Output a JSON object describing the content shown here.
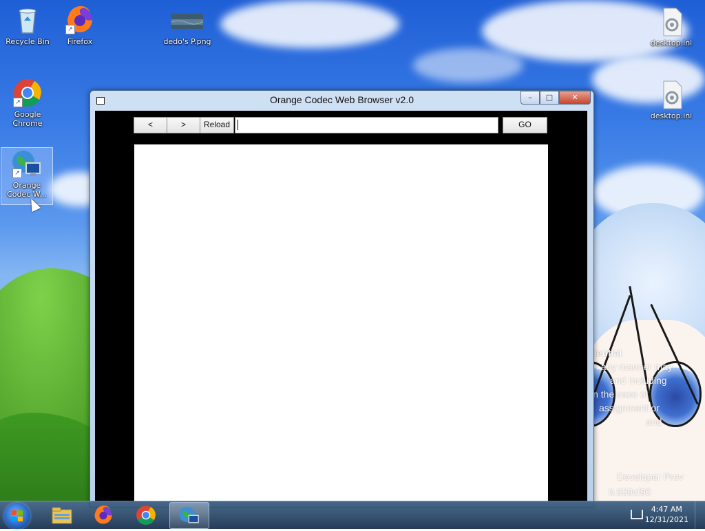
{
  "desktop": {
    "icons": [
      {
        "label": "Recycle Bin",
        "icon": "recycle-bin-icon"
      },
      {
        "label": "Firefox",
        "icon": "firefox-icon"
      },
      {
        "label": "dedo's P.png",
        "icon": "image-file-icon"
      },
      {
        "label": "desktop.ini",
        "icon": "settings-file-icon"
      },
      {
        "label": "Google Chrome",
        "icon": "chrome-icon"
      },
      {
        "label": "desktop.ini",
        "icon": "settings-file-icon"
      },
      {
        "label": "Orange Codec W...",
        "icon": "orange-codec-browser-icon"
      }
    ],
    "wallpaper_text": [
      "dential",
      "in any manner may",
      "and including",
      "in the case of",
      "assignment or",
      "and",
      "Developer Prev",
      "0.959cf95"
    ]
  },
  "window": {
    "title": "Orange Codec Web Browser v2.0",
    "minimize": "–",
    "maximize": "□",
    "close": "✕",
    "back_label": "<",
    "forward_label": ">",
    "reload_label": "Reload",
    "url_value": "",
    "go_label": "GO"
  },
  "taskbar": {
    "time": "4:47 AM",
    "date": "12/31/2021",
    "items": [
      "explorer-icon",
      "firefox-icon",
      "chrome-icon",
      "orange-codec-browser-icon"
    ]
  },
  "colors": {
    "window_frame": "#b9d0ec",
    "client_bg": "#000000",
    "viewport_bg": "#ffffff",
    "close_button": "#c7442c"
  }
}
